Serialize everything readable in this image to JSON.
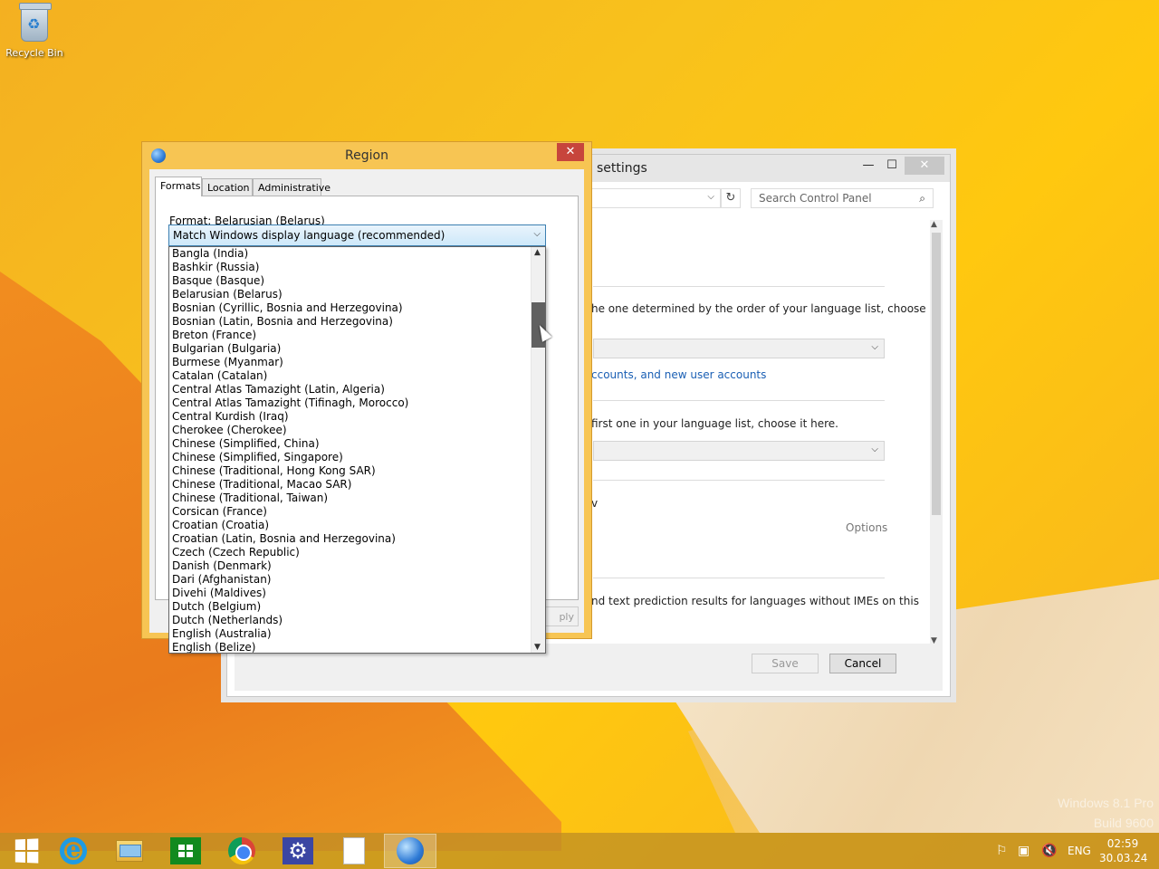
{
  "desktop": {
    "recycle_bin_label": "Recycle Bin",
    "watermark_line1": "Windows 8.1 Pro",
    "watermark_line2": "Build 9600"
  },
  "settings_window": {
    "title": "settings",
    "minimize": "—",
    "maximize": "☐",
    "close": "✕",
    "search_placeholder": "Search Control Panel",
    "text1": "he one determined by the order of your language list, choose",
    "link1": "ccounts, and new user accounts",
    "text2": " first one in your language list, choose it here.",
    "partial_w": "v",
    "options_label": "Options",
    "text3": "nd text prediction results for languages without IMEs on this",
    "save_label": "Save",
    "cancel_label": "Cancel"
  },
  "region_dialog": {
    "title": "Region",
    "close": "✕",
    "tabs": [
      {
        "label": "Formats"
      },
      {
        "label": "Location"
      },
      {
        "label": "Administrative"
      }
    ],
    "format_label": "Format: Belarusian (Belarus)",
    "selected_format": "Match Windows display language (recommended)",
    "apply_partial": "ply",
    "format_options": [
      "Bangla (India)",
      "Bashkir (Russia)",
      "Basque (Basque)",
      "Belarusian (Belarus)",
      "Bosnian (Cyrillic, Bosnia and Herzegovina)",
      "Bosnian (Latin, Bosnia and Herzegovina)",
      "Breton (France)",
      "Bulgarian (Bulgaria)",
      "Burmese (Myanmar)",
      "Catalan (Catalan)",
      "Central Atlas Tamazight (Latin, Algeria)",
      "Central Atlas Tamazight (Tifinagh, Morocco)",
      "Central Kurdish (Iraq)",
      "Cherokee (Cherokee)",
      "Chinese (Simplified, China)",
      "Chinese (Simplified, Singapore)",
      "Chinese (Traditional, Hong Kong SAR)",
      "Chinese (Traditional, Macao SAR)",
      "Chinese (Traditional, Taiwan)",
      "Corsican (France)",
      "Croatian (Croatia)",
      "Croatian (Latin, Bosnia and Herzegovina)",
      "Czech (Czech Republic)",
      "Danish (Denmark)",
      "Dari (Afghanistan)",
      "Divehi (Maldives)",
      "Dutch (Belgium)",
      "Dutch (Netherlands)",
      "English (Australia)",
      "English (Belize)"
    ]
  },
  "taskbar": {
    "language": "ENG",
    "time": "02:59",
    "date": "30.03.24"
  }
}
